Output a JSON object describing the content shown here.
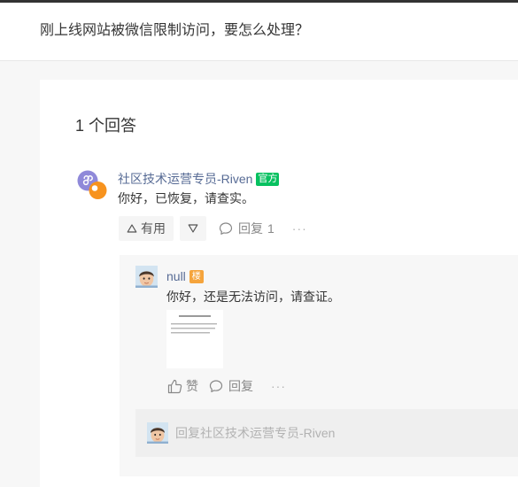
{
  "question": {
    "title": "刚上线网站被微信限制访问，要怎么处理？"
  },
  "answers_section": {
    "count_label": "1 个回答"
  },
  "answer": {
    "author": "社区技术运营专员-Riven",
    "badge": "官方",
    "content": "你好，已恢复，请查实。",
    "actions": {
      "useful_label": "有用",
      "reply_label": "回复",
      "reply_count": "1",
      "more_label": "···"
    }
  },
  "reply": {
    "author": "null",
    "badge": "楼",
    "content": "你好，还是无法访问，请查证。",
    "actions": {
      "like_label": "赞",
      "reply_label": "回复",
      "more_label": "···"
    },
    "reply_input": {
      "placeholder": "回复社区技术运营专员-Riven"
    }
  },
  "icons": {
    "useful": "triangle-up-icon",
    "not_useful": "triangle-down-icon",
    "comment": "comment-icon",
    "like": "thumbs-up-icon"
  },
  "colors": {
    "top_bar": "#333333",
    "page_background": "#f7f7f7",
    "name_link": "#576b95",
    "official_badge": "#07c160",
    "op_badge": "#f5a43c",
    "reply_background": "#f7f7f7",
    "nested_reply_background": "#efefef"
  }
}
